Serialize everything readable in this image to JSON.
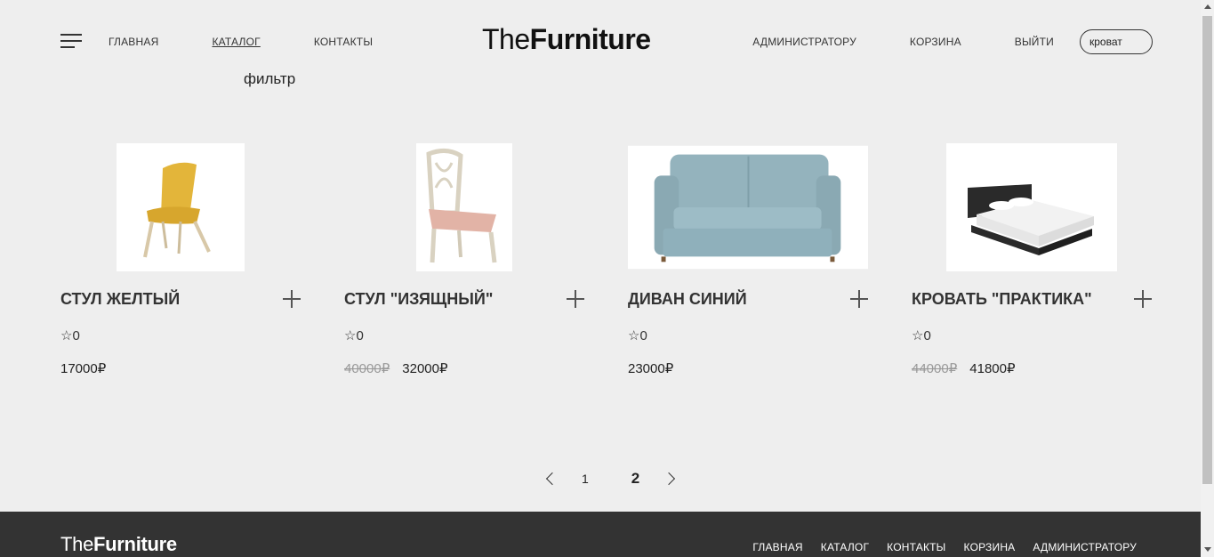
{
  "header": {
    "nav_left": [
      "ГЛАВНАЯ",
      "КАТАЛОГ",
      "КОНТАКТЫ"
    ],
    "logo_light": "The",
    "logo_bold": "Furniture",
    "nav_right": [
      "АДМИНИСТРАТОРУ",
      "КОРЗИНА",
      "ВЫЙТИ"
    ],
    "search_value": "кроват"
  },
  "filter_label": "фильтр",
  "products": [
    {
      "title": "СТУЛ ЖЕЛТЫЙ",
      "rating": "☆0",
      "price": "17000₽",
      "old_price": ""
    },
    {
      "title": "СТУЛ \"ИЗЯЩНЫЙ\"",
      "rating": "☆0",
      "price": "32000₽",
      "old_price": "40000₽"
    },
    {
      "title": "ДИВАН СИНИЙ",
      "rating": "☆0",
      "price": "23000₽",
      "old_price": ""
    },
    {
      "title": "КРОВАТЬ \"ПРАКТИКА\"",
      "rating": "☆0",
      "price": "41800₽",
      "old_price": "44000₽"
    }
  ],
  "pagination": {
    "pages": [
      "1",
      "2"
    ],
    "current": "2"
  },
  "footer": {
    "logo_light": "The",
    "logo_bold": "Furniture",
    "nav": [
      "ГЛАВНАЯ",
      "КАТАЛОГ",
      "КОНТАКТЫ",
      "КОРЗИНА",
      "АДМИНИСТРАТОРУ"
    ]
  },
  "colors": {
    "background": "#eeeeee",
    "footer": "#333333",
    "chair_yellow": "#e3b53a",
    "sofa_blue": "#8fb0bb",
    "bed_black": "#2a2a2a"
  }
}
